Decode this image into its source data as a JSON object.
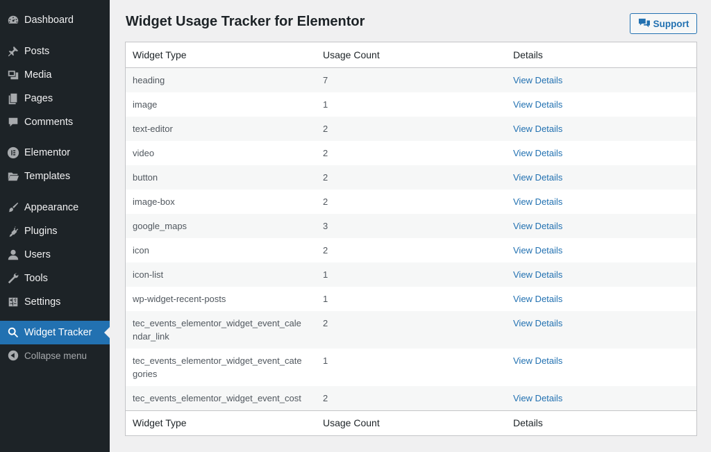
{
  "sidebar": {
    "items": [
      {
        "label": "Dashboard",
        "icon": "dashboard-icon"
      },
      {
        "label": "Posts",
        "icon": "pin-icon"
      },
      {
        "label": "Media",
        "icon": "media-icon"
      },
      {
        "label": "Pages",
        "icon": "pages-icon"
      },
      {
        "label": "Comments",
        "icon": "comment-icon"
      },
      {
        "label": "Elementor",
        "icon": "elementor-icon"
      },
      {
        "label": "Templates",
        "icon": "folder-icon"
      },
      {
        "label": "Appearance",
        "icon": "brush-icon"
      },
      {
        "label": "Plugins",
        "icon": "plugin-icon"
      },
      {
        "label": "Users",
        "icon": "user-icon"
      },
      {
        "label": "Tools",
        "icon": "wrench-icon"
      },
      {
        "label": "Settings",
        "icon": "settings-icon"
      },
      {
        "label": "Widget Tracker",
        "icon": "search-icon"
      },
      {
        "label": "Collapse menu",
        "icon": "collapse-icon"
      }
    ]
  },
  "header": {
    "title": "Widget Usage Tracker for Elementor",
    "support_label": "Support"
  },
  "table": {
    "columns": [
      "Widget Type",
      "Usage Count",
      "Details"
    ],
    "rows": [
      {
        "type": "heading",
        "count": "7",
        "link": "View Details"
      },
      {
        "type": "image",
        "count": "1",
        "link": "View Details"
      },
      {
        "type": "text-editor",
        "count": "2",
        "link": "View Details"
      },
      {
        "type": "video",
        "count": "2",
        "link": "View Details"
      },
      {
        "type": "button",
        "count": "2",
        "link": "View Details"
      },
      {
        "type": "image-box",
        "count": "2",
        "link": "View Details"
      },
      {
        "type": "google_maps",
        "count": "3",
        "link": "View Details"
      },
      {
        "type": "icon",
        "count": "2",
        "link": "View Details"
      },
      {
        "type": "icon-list",
        "count": "1",
        "link": "View Details"
      },
      {
        "type": "wp-widget-recent-posts",
        "count": "1",
        "link": "View Details"
      },
      {
        "type": "tec_events_elementor_widget_event_calendar_link",
        "count": "2",
        "link": "View Details"
      },
      {
        "type": "tec_events_elementor_widget_event_categories",
        "count": "1",
        "link": "View Details"
      },
      {
        "type": "tec_events_elementor_widget_event_cost",
        "count": "2",
        "link": "View Details"
      }
    ]
  },
  "colors": {
    "sidebar_bg": "#1d2327",
    "accent": "#2271b1",
    "page_bg": "#f0f0f1"
  }
}
